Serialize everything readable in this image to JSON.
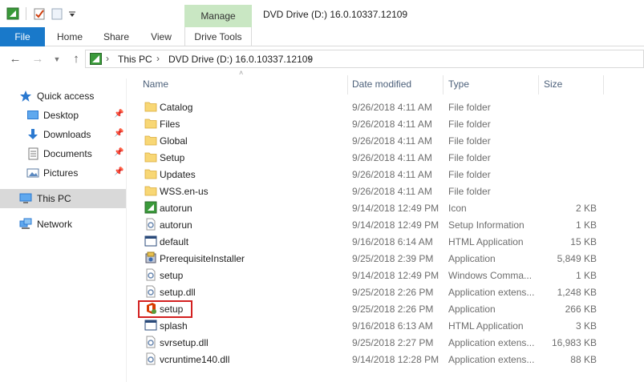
{
  "window": {
    "title": "DVD Drive (D:) 16.0.10337.12109",
    "contextual_group": "Manage"
  },
  "ribbon": {
    "tabs": [
      "File",
      "Home",
      "Share",
      "View",
      "Drive Tools"
    ],
    "accent_color": "#1979ca",
    "context_color": "#c9e7c3"
  },
  "address": {
    "crumbs": [
      "This PC",
      "DVD Drive (D:) 16.0.10337.12109"
    ]
  },
  "nav": {
    "quick_access": "Quick access",
    "items": [
      {
        "label": "Desktop",
        "icon": "desktop-icon",
        "pinned": true
      },
      {
        "label": "Downloads",
        "icon": "downloads-icon",
        "pinned": true
      },
      {
        "label": "Documents",
        "icon": "documents-icon",
        "pinned": true
      },
      {
        "label": "Pictures",
        "icon": "pictures-icon",
        "pinned": true
      }
    ],
    "this_pc": "This PC",
    "network": "Network"
  },
  "columns": {
    "name": "Name",
    "date": "Date modified",
    "type": "Type",
    "size": "Size"
  },
  "files": [
    {
      "name": "Catalog",
      "date": "9/26/2018 4:11 AM",
      "type": "File folder",
      "size": "",
      "icon": "folder"
    },
    {
      "name": "Files",
      "date": "9/26/2018 4:11 AM",
      "type": "File folder",
      "size": "",
      "icon": "folder"
    },
    {
      "name": "Global",
      "date": "9/26/2018 4:11 AM",
      "type": "File folder",
      "size": "",
      "icon": "folder"
    },
    {
      "name": "Setup",
      "date": "9/26/2018 4:11 AM",
      "type": "File folder",
      "size": "",
      "icon": "folder"
    },
    {
      "name": "Updates",
      "date": "9/26/2018 4:11 AM",
      "type": "File folder",
      "size": "",
      "icon": "folder"
    },
    {
      "name": "WSS.en-us",
      "date": "9/26/2018 4:11 AM",
      "type": "File folder",
      "size": "",
      "icon": "folder"
    },
    {
      "name": "autorun",
      "date": "9/14/2018 12:49 PM",
      "type": "Icon",
      "size": "2 KB",
      "icon": "green"
    },
    {
      "name": "autorun",
      "date": "9/14/2018 12:49 PM",
      "type": "Setup Information",
      "size": "1 KB",
      "icon": "settings"
    },
    {
      "name": "default",
      "date": "9/16/2018 6:14 AM",
      "type": "HTML Application",
      "size": "15 KB",
      "icon": "hta"
    },
    {
      "name": "PrerequisiteInstaller",
      "date": "9/25/2018 2:39 PM",
      "type": "Application",
      "size": "5,849 KB",
      "icon": "installer"
    },
    {
      "name": "setup",
      "date": "9/14/2018 12:49 PM",
      "type": "Windows Comma...",
      "size": "1 KB",
      "icon": "settings"
    },
    {
      "name": "setup.dll",
      "date": "9/25/2018 2:26 PM",
      "type": "Application extens...",
      "size": "1,248 KB",
      "icon": "settings"
    },
    {
      "name": "setup",
      "date": "9/25/2018 2:26 PM",
      "type": "Application",
      "size": "266 KB",
      "icon": "office"
    },
    {
      "name": "splash",
      "date": "9/16/2018 6:13 AM",
      "type": "HTML Application",
      "size": "3 KB",
      "icon": "hta"
    },
    {
      "name": "svrsetup.dll",
      "date": "9/25/2018 2:27 PM",
      "type": "Application extens...",
      "size": "16,983 KB",
      "icon": "settings"
    },
    {
      "name": "vcruntime140.dll",
      "date": "9/14/2018 12:28 PM",
      "type": "Application extens...",
      "size": "88 KB",
      "icon": "settings"
    }
  ],
  "highlighted_file_index": 12
}
